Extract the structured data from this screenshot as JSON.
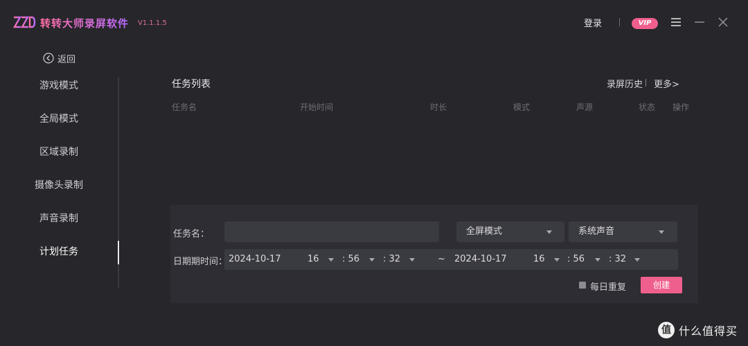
{
  "app": {
    "title": "转转大师录屏软件",
    "version": "V1.1.1.5",
    "logo_icon": "zzd-logo-icon"
  },
  "titlebar": {
    "login_label": "登录",
    "vip_label": "VIP",
    "menu_icon": "hamburger-menu-icon",
    "minimize_icon": "minimize-icon",
    "close_icon": "close-icon"
  },
  "nav": {
    "back_label": "返回",
    "back_icon": "chevron-left-circle-icon"
  },
  "sidebar": {
    "items": [
      {
        "label": "游戏模式"
      },
      {
        "label": "全局模式"
      },
      {
        "label": "区域录制"
      },
      {
        "label": "摄像头录制"
      },
      {
        "label": "声音录制"
      },
      {
        "label": "计划任务"
      }
    ],
    "active": "计划任务"
  },
  "task_list": {
    "title": "任务列表",
    "history_label": "录屏历史",
    "more_label": "更多>",
    "columns": [
      "任务名",
      "开始时间",
      "时长",
      "模式",
      "声源",
      "状态",
      "操作"
    ]
  },
  "form": {
    "name_label": "任务名：",
    "name_value": "",
    "mode_select": "全屏模式",
    "audio_select": "系统声音",
    "datetime_label": "日期期时间：",
    "start_date": "2024-10-17",
    "start_hour": "16",
    "start_minute": ": 56",
    "start_second": ": 32",
    "range_sep": "~",
    "end_date": "2024-10-17",
    "end_hour": "16",
    "end_minute": ": 56",
    "end_second": ": 32",
    "repeat_label": "每日重复",
    "repeat_checked": false,
    "create_label": "创建"
  },
  "watermark": {
    "badge": "值",
    "text": "什么值得买"
  },
  "colors": {
    "accent": "#ef5f8d",
    "background": "#26262b",
    "panel": "#2d2d33",
    "field": "#3a3a41"
  }
}
